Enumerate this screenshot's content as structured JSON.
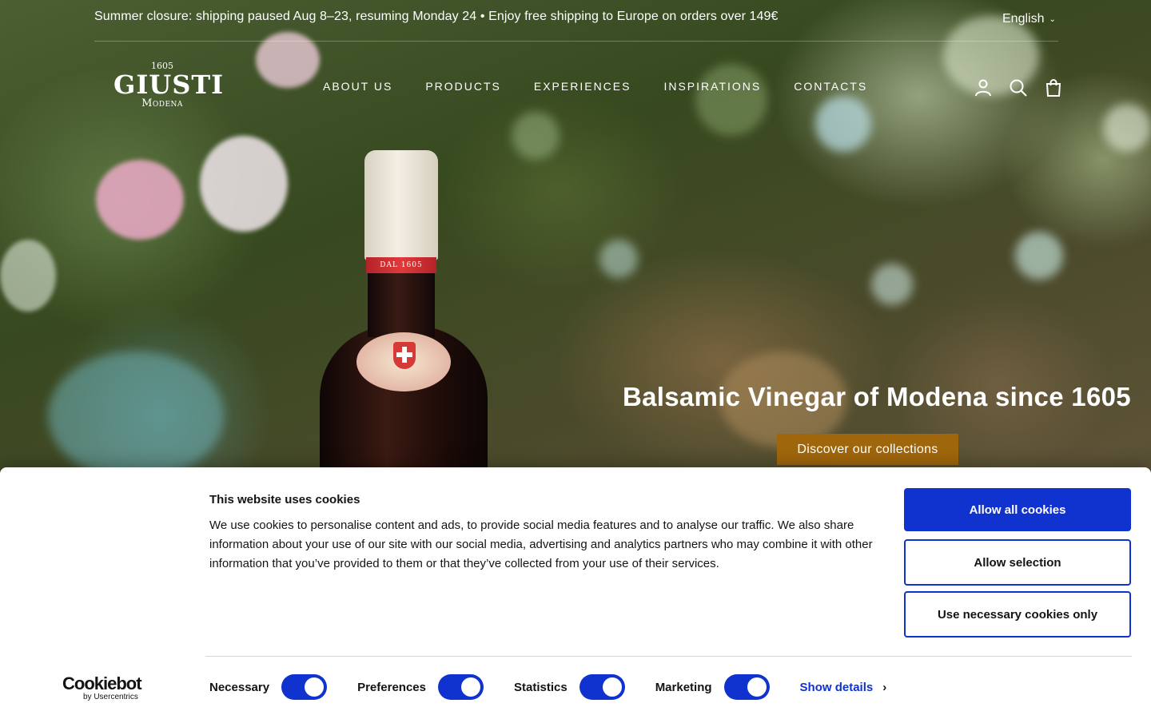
{
  "announcement": "Summer closure: shipping paused Aug 8–23, resuming Monday 24 • Enjoy free shipping to Europe on orders over 149€",
  "language": "English",
  "logo": {
    "year": "1605",
    "brand": "GIUSTI",
    "city": "Modena"
  },
  "bottle_band": "DAL 1605",
  "nav": {
    "items": [
      "ABOUT US",
      "PRODUCTS",
      "EXPERIENCES",
      "INSPIRATIONS",
      "CONTACTS"
    ],
    "icons": [
      "account-icon",
      "search-icon",
      "bag-icon"
    ]
  },
  "hero": {
    "title": "Balsamic Vinegar of Modena since 1605",
    "cta": "Discover our collections",
    "cta_color": "#a0660c"
  },
  "cookie": {
    "title": "This website uses cookies",
    "text": "We use cookies to personalise content and ads, to provide social media features and to analyse our traffic. We also share information about your use of our site with our social media, advertising and analytics partners who may combine it with other information that you’ve provided to them or that they’ve collected from your use of their services.",
    "buttons": {
      "allow_all": "Allow all cookies",
      "allow_selection": "Allow selection",
      "necessary_only": "Use necessary cookies only"
    },
    "toggles": [
      {
        "label": "Necessary",
        "on": true
      },
      {
        "label": "Preferences",
        "on": true
      },
      {
        "label": "Statistics",
        "on": true
      },
      {
        "label": "Marketing",
        "on": true
      }
    ],
    "show_details": "Show details",
    "brand_main": "Cookiebot",
    "brand_sub": "by Usercentrics",
    "accent_color": "#1032cf"
  }
}
